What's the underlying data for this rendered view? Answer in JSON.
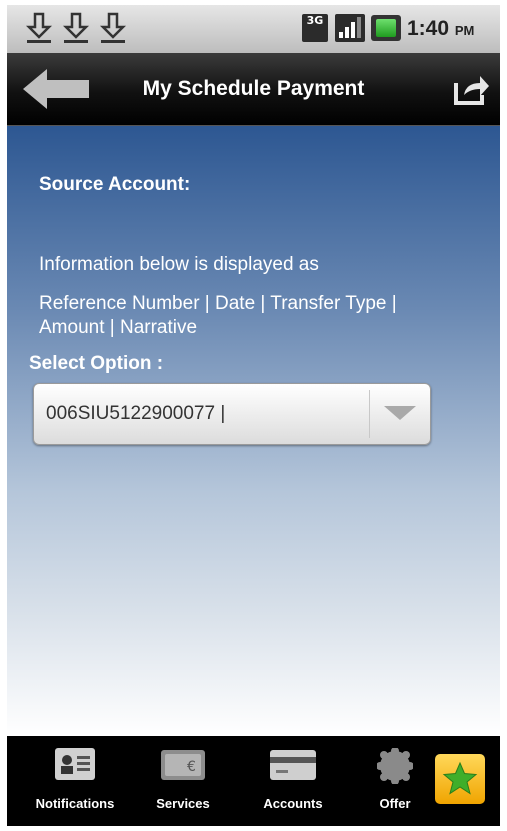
{
  "status_bar": {
    "network": "3G",
    "time": "1:40",
    "ampm": "PM"
  },
  "header": {
    "title": "My Schedule Payment"
  },
  "main": {
    "source_account_label": "Source Account:",
    "info_line": "Information below is displayed as",
    "format_line": "Reference Number | Date | Transfer Type | Amount | Narrative",
    "select_label": "Select Option :",
    "selected_option": "006SIU5122900077 |"
  },
  "tabs": [
    {
      "label": "Notifications",
      "icon": "contact-card-icon"
    },
    {
      "label": "Services",
      "icon": "wallet-icon"
    },
    {
      "label": "Accounts",
      "icon": "credit-card-icon"
    },
    {
      "label": "Offer",
      "icon": "gear-badge-icon"
    }
  ],
  "colors": {
    "content_top": "#2d5792",
    "titlebar": "#000000",
    "star_button": "#f0a400"
  }
}
